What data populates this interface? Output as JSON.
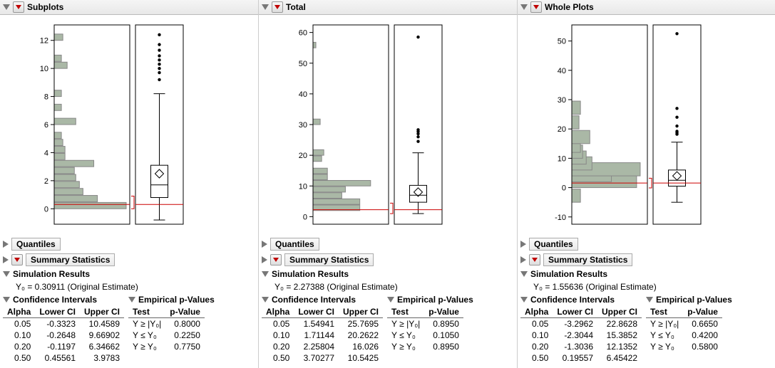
{
  "chart_data": [
    {
      "panel": "Subplots",
      "type": "histogram+box",
      "y_ticks": [
        0,
        2,
        4,
        6,
        8,
        10,
        12
      ],
      "ylim": [
        -1,
        13
      ],
      "hist_bins": [
        {
          "y": 0,
          "w": 1.0
        },
        {
          "y": 0.5,
          "w": 0.6
        },
        {
          "y": 1,
          "w": 0.4
        },
        {
          "y": 1.5,
          "w": 0.35
        },
        {
          "y": 2,
          "w": 0.3
        },
        {
          "y": 2.5,
          "w": 0.28
        },
        {
          "y": 3,
          "w": 0.55
        },
        {
          "y": 3.5,
          "w": 0.15
        },
        {
          "y": 4,
          "w": 0.15
        },
        {
          "y": 4.5,
          "w": 0.12
        },
        {
          "y": 5,
          "w": 0.1
        },
        {
          "y": 6,
          "w": 0.3
        },
        {
          "y": 7,
          "w": 0.1
        },
        {
          "y": 8,
          "w": 0.1
        },
        {
          "y": 10,
          "w": 0.18
        },
        {
          "y": 10.5,
          "w": 0.1
        },
        {
          "y": 12,
          "w": 0.12
        }
      ],
      "box": {
        "min": -0.8,
        "q1": 0.8,
        "median": 1.7,
        "mean": 2.5,
        "q3": 3.1,
        "max": 8.2,
        "outliers": [
          9.2,
          9.7,
          10.0,
          10.3,
          10.6,
          10.9,
          11.3,
          11.7,
          12.4
        ]
      },
      "ref_line": 0.30911,
      "bracket": [
        0,
        0.9
      ]
    },
    {
      "panel": "Total",
      "type": "histogram+box",
      "y_ticks": [
        0,
        10,
        20,
        30,
        40,
        50,
        60
      ],
      "ylim": [
        -2,
        62
      ],
      "hist_bins": [
        {
          "y": 2,
          "w": 0.65
        },
        {
          "y": 4,
          "w": 0.65
        },
        {
          "y": 6,
          "w": 0.4
        },
        {
          "y": 8,
          "w": 0.45
        },
        {
          "y": 10,
          "w": 0.8
        },
        {
          "y": 12,
          "w": 0.2
        },
        {
          "y": 14,
          "w": 0.2
        },
        {
          "y": 18,
          "w": 0.12
        },
        {
          "y": 20,
          "w": 0.15
        },
        {
          "y": 30,
          "w": 0.1
        },
        {
          "y": 55,
          "w": 0.04
        }
      ],
      "box": {
        "min": 1.0,
        "q1": 4.7,
        "median": 7.0,
        "mean": 8.0,
        "q3": 10.2,
        "max": 20.8,
        "outliers": [
          24.5,
          26.0,
          27.0,
          27.7,
          28.3,
          58.5
        ]
      },
      "ref_line": 2.27388,
      "bracket": [
        1.0,
        4.4
      ]
    },
    {
      "panel": "Whole Plots",
      "type": "histogram+box",
      "y_ticks": [
        -10,
        0,
        10,
        20,
        30,
        40,
        50
      ],
      "ylim": [
        -12,
        55
      ],
      "hist_bins": [
        {
          "y": -5,
          "w": 0.12
        },
        {
          "y": 0,
          "w": 0.9
        },
        {
          "y": 2,
          "w": 0.55
        },
        {
          "y": 4,
          "w": 0.95
        },
        {
          "y": 6,
          "w": 0.28
        },
        {
          "y": 8,
          "w": 0.2
        },
        {
          "y": 10,
          "w": 0.15
        },
        {
          "y": 12,
          "w": 0.12
        },
        {
          "y": 15,
          "w": 0.25
        },
        {
          "y": 20,
          "w": 0.1
        },
        {
          "y": 25,
          "w": 0.12
        }
      ],
      "box": {
        "min": -5.0,
        "q1": 0.5,
        "median": 2.5,
        "mean": 4.0,
        "q3": 6.0,
        "max": 15.5,
        "outliers": [
          18.2,
          18.7,
          19.2,
          21.0,
          24.0,
          27.0,
          52.5
        ]
      },
      "ref_line": 1.55636,
      "bracket": [
        -0.1,
        3.2
      ]
    }
  ],
  "panels": [
    {
      "title": "Subplots",
      "quantiles": "Quantiles",
      "summary": "Summary Statistics",
      "simres": "Simulation Results",
      "estimate": "Y₀ = 0.30911 (Original Estimate)",
      "ci_title": "Confidence Intervals",
      "pv_title": "Empirical p-Values",
      "ci_headers": [
        "Alpha",
        "Lower CI",
        "Upper CI"
      ],
      "ci_rows": [
        [
          "0.05",
          "-0.3323",
          "10.4589"
        ],
        [
          "0.10",
          "-0.2648",
          "9.66902"
        ],
        [
          "0.20",
          "-0.1197",
          "6.34662"
        ],
        [
          "0.50",
          "0.45561",
          "3.9783"
        ]
      ],
      "pv_headers": [
        "Test",
        "p-Value"
      ],
      "pv_rows": [
        [
          "Y ≥ |Y₀|",
          "0.8000"
        ],
        [
          "Y ≤ Y₀",
          "0.2250"
        ],
        [
          "Y ≥ Y₀",
          "0.7750"
        ]
      ]
    },
    {
      "title": "Total",
      "quantiles": "Quantiles",
      "summary": "Summary Statistics",
      "simres": "Simulation Results",
      "estimate": "Y₀ = 2.27388 (Original Estimate)",
      "ci_title": "Confidence Intervals",
      "pv_title": "Empirical p-Values",
      "ci_headers": [
        "Alpha",
        "Lower CI",
        "Upper CI"
      ],
      "ci_rows": [
        [
          "0.05",
          "1.54941",
          "25.7695"
        ],
        [
          "0.10",
          "1.71144",
          "20.2622"
        ],
        [
          "0.20",
          "2.25804",
          "16.026"
        ],
        [
          "0.50",
          "3.70277",
          "10.5425"
        ]
      ],
      "pv_headers": [
        "Test",
        "p-Value"
      ],
      "pv_rows": [
        [
          "Y ≥ |Y₀|",
          "0.8950"
        ],
        [
          "Y ≤ Y₀",
          "0.1050"
        ],
        [
          "Y ≥ Y₀",
          "0.8950"
        ]
      ]
    },
    {
      "title": "Whole Plots",
      "quantiles": "Quantiles",
      "summary": "Summary Statistics",
      "simres": "Simulation Results",
      "estimate": "Y₀ = 1.55636 (Original Estimate)",
      "ci_title": "Confidence Intervals",
      "pv_title": "Empirical p-Values",
      "ci_headers": [
        "Alpha",
        "Lower CI",
        "Upper CI"
      ],
      "ci_rows": [
        [
          "0.05",
          "-3.2962",
          "22.8628"
        ],
        [
          "0.10",
          "-2.3044",
          "15.3852"
        ],
        [
          "0.20",
          "-1.3036",
          "12.1352"
        ],
        [
          "0.50",
          "0.19557",
          "6.45422"
        ]
      ],
      "pv_headers": [
        "Test",
        "p-Value"
      ],
      "pv_rows": [
        [
          "Y ≥ |Y₀|",
          "0.6650"
        ],
        [
          "Y ≤ Y₀",
          "0.4200"
        ],
        [
          "Y ≥ Y₀",
          "0.5800"
        ]
      ]
    }
  ]
}
